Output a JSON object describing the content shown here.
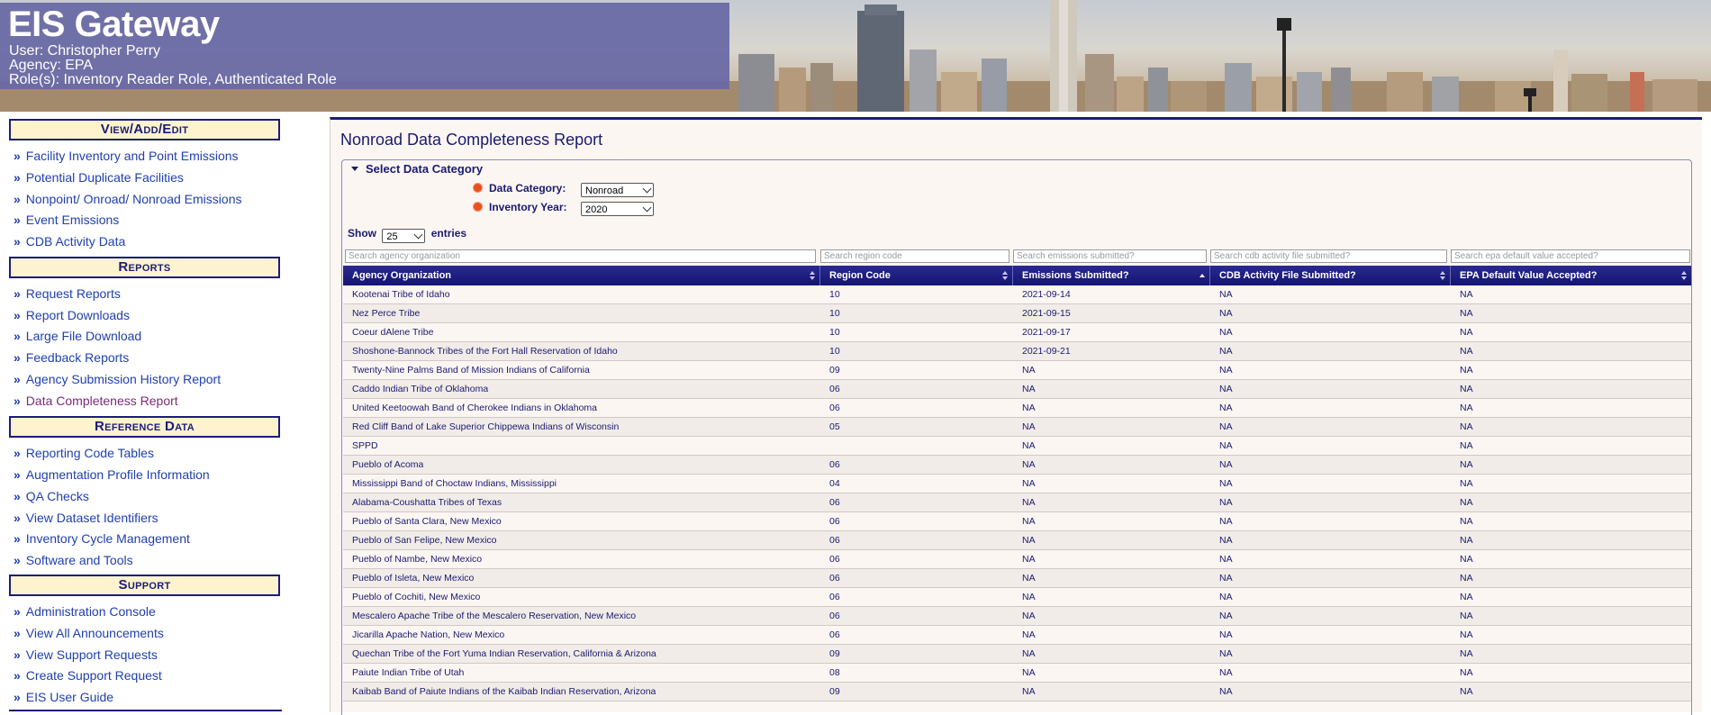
{
  "header": {
    "title": "EIS Gateway",
    "user": "User: Christopher Perry",
    "agency": "Agency: EPA",
    "roles": "Role(s): Inventory Reader Role, Authenticated Role"
  },
  "sidebar": {
    "sections": [
      {
        "heading": "View/Add/Edit",
        "items": [
          "Facility Inventory and Point Emissions",
          "Potential Duplicate Facilities",
          "Nonpoint/ Onroad/ Nonroad Emissions",
          "Event Emissions",
          "CDB Activity Data"
        ]
      },
      {
        "heading": "Reports",
        "items": [
          "Request Reports",
          "Report Downloads",
          "Large File Download",
          "Feedback Reports",
          "Agency Submission History Report",
          "Data Completeness Report"
        ]
      },
      {
        "heading": "Reference Data",
        "items": [
          "Reporting Code Tables",
          "Augmentation Profile Information",
          "QA Checks",
          "View Dataset Identifiers",
          "Inventory Cycle Management",
          "Software and Tools"
        ]
      },
      {
        "heading": "Support",
        "items": [
          "Administration Console",
          "View All Announcements",
          "View Support Requests",
          "Create Support Request",
          "EIS User Guide"
        ]
      }
    ],
    "bullet": "»"
  },
  "main": {
    "title": "Nonroad Data Completeness Report",
    "section_legend": "Select Data Category",
    "data_category_label": "Data Category:",
    "data_category_value": "Nonroad",
    "inventory_year_label": "Inventory Year:",
    "inventory_year_value": "2020",
    "show_label": "Show",
    "entries_value": "25",
    "entries_label": "entries",
    "search_placeholders": [
      "Search agency organization",
      "Search region code",
      "Search emissions submitted?",
      "Search cdb activity file submitted?",
      "Search epa default value accepted?"
    ],
    "columns": [
      "Agency Organization",
      "Region Code",
      "Emissions Submitted?",
      "CDB Activity File Submitted?",
      "EPA Default Value Accepted?"
    ],
    "rows": [
      [
        "Kootenai Tribe of Idaho",
        "10",
        "2021-09-14",
        "NA",
        "NA"
      ],
      [
        "Nez Perce Tribe",
        "10",
        "2021-09-15",
        "NA",
        "NA"
      ],
      [
        "Coeur dAlene Tribe",
        "10",
        "2021-09-17",
        "NA",
        "NA"
      ],
      [
        "Shoshone-Bannock Tribes of the Fort Hall Reservation of Idaho",
        "10",
        "2021-09-21",
        "NA",
        "NA"
      ],
      [
        "Twenty-Nine Palms Band of Mission Indians of California",
        "09",
        "NA",
        "NA",
        "NA"
      ],
      [
        "Caddo Indian Tribe of Oklahoma",
        "06",
        "NA",
        "NA",
        "NA"
      ],
      [
        "United Keetoowah Band of Cherokee Indians in Oklahoma",
        "06",
        "NA",
        "NA",
        "NA"
      ],
      [
        "Red Cliff Band of Lake Superior Chippewa Indians of Wisconsin",
        "05",
        "NA",
        "NA",
        "NA"
      ],
      [
        "SPPD",
        "",
        "NA",
        "NA",
        "NA"
      ],
      [
        "Pueblo of Acoma",
        "06",
        "NA",
        "NA",
        "NA"
      ],
      [
        "Mississippi Band of Choctaw Indians, Mississippi",
        "04",
        "NA",
        "NA",
        "NA"
      ],
      [
        "Alabama-Coushatta Tribes of Texas",
        "06",
        "NA",
        "NA",
        "NA"
      ],
      [
        "Pueblo of Santa Clara, New Mexico",
        "06",
        "NA",
        "NA",
        "NA"
      ],
      [
        "Pueblo of San Felipe, New Mexico",
        "06",
        "NA",
        "NA",
        "NA"
      ],
      [
        "Pueblo of Nambe, New Mexico",
        "06",
        "NA",
        "NA",
        "NA"
      ],
      [
        "Pueblo of Isleta, New Mexico",
        "06",
        "NA",
        "NA",
        "NA"
      ],
      [
        "Pueblo of Cochiti, New Mexico",
        "06",
        "NA",
        "NA",
        "NA"
      ],
      [
        "Mescalero Apache Tribe of the Mescalero Reservation, New Mexico",
        "06",
        "NA",
        "NA",
        "NA"
      ],
      [
        "Jicarilla Apache Nation, New Mexico",
        "06",
        "NA",
        "NA",
        "NA"
      ],
      [
        "Quechan Tribe of the Fort Yuma Indian Reservation, California & Arizona",
        "09",
        "NA",
        "NA",
        "NA"
      ],
      [
        "Paiute Indian Tribe of Utah",
        "08",
        "NA",
        "NA",
        "NA"
      ],
      [
        "Kaibab Band of Paiute Indians of the Kaibab Indian Reservation, Arizona",
        "09",
        "NA",
        "NA",
        "NA"
      ]
    ]
  },
  "colors": {
    "navy": "#1c1c7a",
    "link": "#1f3fb0",
    "visited": "#7a2a7a",
    "section_bg": "#fdf3cf",
    "title_overlay": "#6868a5",
    "required": "#e8501e"
  }
}
